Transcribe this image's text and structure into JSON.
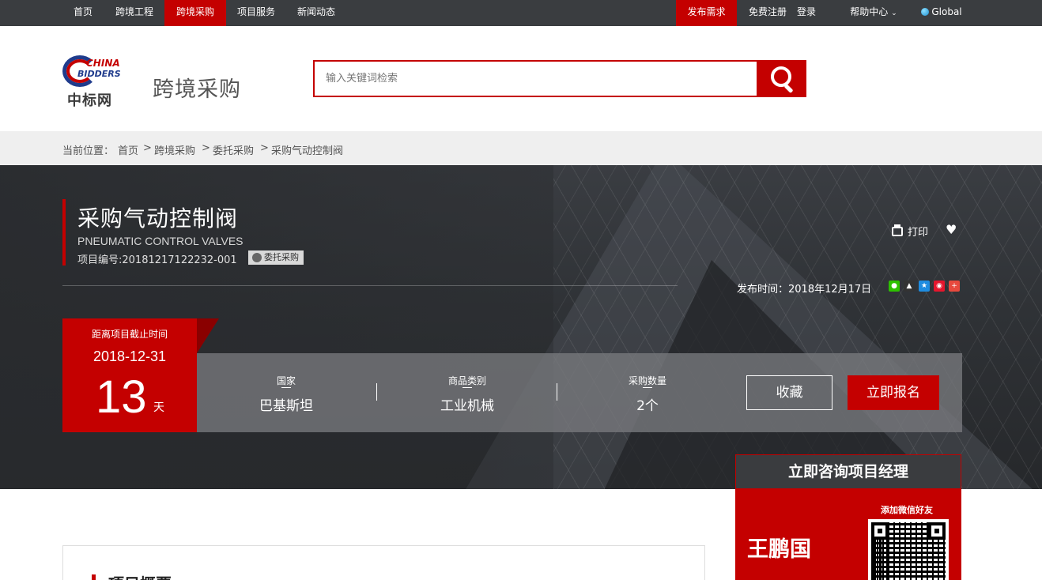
{
  "topnav": {
    "left": [
      "首页",
      "跨境工程",
      "跨境采购",
      "项目服务",
      "新闻动态"
    ],
    "active": "跨境采购",
    "publish": "发布需求",
    "register": "免费注册",
    "login": "登录",
    "help": "帮助中心",
    "global": "Global"
  },
  "header": {
    "logo_en_line1": "CHINA",
    "logo_en_line2": "BIDDERS",
    "logo_cn": "中标网",
    "section": "跨境采购",
    "search_placeholder": "输入关键词检索"
  },
  "breadcrumb": {
    "prefix": "当前位置：",
    "items": [
      "首页",
      "跨境采购",
      "委托采购",
      "采购气动控制阀"
    ],
    "sep": ">"
  },
  "project": {
    "title": "采购气动控制阀",
    "title_en": "PNEUMATIC CONTROL VALVES",
    "number": "项目编号:20181217122232-001",
    "tag": "委托采购",
    "print": "打印",
    "published": "发布时间：2018年12月17日"
  },
  "deadline": {
    "label": "距离项目截止时间",
    "date": "2018-12-31",
    "days": "13",
    "unit": "天"
  },
  "info": [
    {
      "key": "国家",
      "value": "巴基斯坦"
    },
    {
      "key": "商品类别",
      "value": "工业机械"
    },
    {
      "key": "采购数量",
      "value": "2个"
    }
  ],
  "actions": {
    "favorite": "收藏",
    "register": "立即报名"
  },
  "share_colors": [
    "#2dc100",
    "#333333",
    "#1f8ce0",
    "#e6162d",
    "#e8493d"
  ],
  "consult": {
    "title": "立即咨询项目经理",
    "wechat": "添加微信好友",
    "name": "王鹏国"
  },
  "overview": {
    "title": "项目概要"
  },
  "colors": {
    "accent": "#c40000",
    "topbar": "#3a3d40"
  }
}
